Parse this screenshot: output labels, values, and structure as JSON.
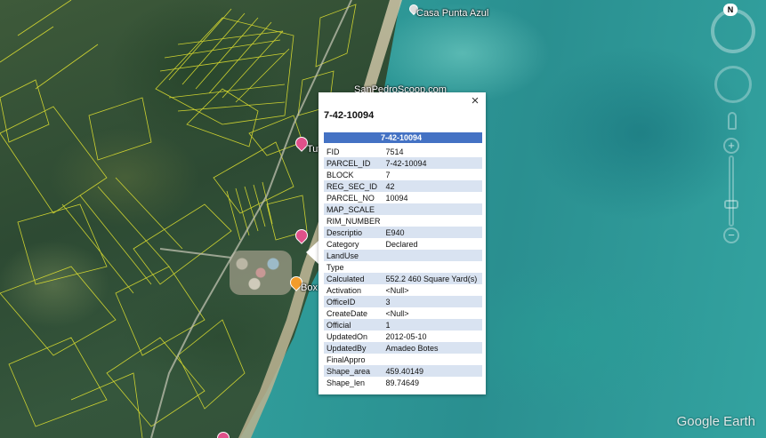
{
  "map": {
    "places": [
      {
        "id": "casa",
        "label": "Casa Punta Azul"
      },
      {
        "id": "sanpedro",
        "label": "SanPedroScoop.com"
      },
      {
        "id": "tuto",
        "label": "Tuto"
      },
      {
        "id": "box",
        "label": "Box"
      }
    ],
    "watermark": "Google Earth",
    "colors": {
      "parcel_lines": "#e8e830",
      "sea": "#2f9b99",
      "land": "#35563c"
    }
  },
  "navigation": {
    "compass_label": "N",
    "zoom_in": "+",
    "zoom_out": "−"
  },
  "balloon": {
    "title": "7-42-10094",
    "close_label": "×",
    "table_header": "7-42-10094",
    "header_color": "#4472c4",
    "rows": [
      {
        "key": "FID",
        "value": "7514"
      },
      {
        "key": "PARCEL_ID",
        "value": "7-42-10094"
      },
      {
        "key": "BLOCK",
        "value": "7"
      },
      {
        "key": "REG_SEC_ID",
        "value": "42"
      },
      {
        "key": "PARCEL_NO",
        "value": "10094"
      },
      {
        "key": "MAP_SCALE",
        "value": ""
      },
      {
        "key": "RIM_NUMBER",
        "value": ""
      },
      {
        "key": "Descriptio",
        "value": "E940"
      },
      {
        "key": "Category",
        "value": "Declared"
      },
      {
        "key": "LandUse",
        "value": ""
      },
      {
        "key": "Type",
        "value": ""
      },
      {
        "key": "Calculated",
        "value": "552.2 460 Square Yard(s)"
      },
      {
        "key": "Activation",
        "value": "<Null>"
      },
      {
        "key": "OfficeID",
        "value": "3"
      },
      {
        "key": "CreateDate",
        "value": "<Null>"
      },
      {
        "key": "Official",
        "value": "1"
      },
      {
        "key": "UpdatedOn",
        "value": "2012-05-10"
      },
      {
        "key": "UpdatedBy",
        "value": "Amadeo Botes"
      },
      {
        "key": "FinalAppro",
        "value": ""
      },
      {
        "key": "Shape_area",
        "value": "459.40149"
      },
      {
        "key": "Shape_len",
        "value": "89.74649"
      }
    ]
  }
}
